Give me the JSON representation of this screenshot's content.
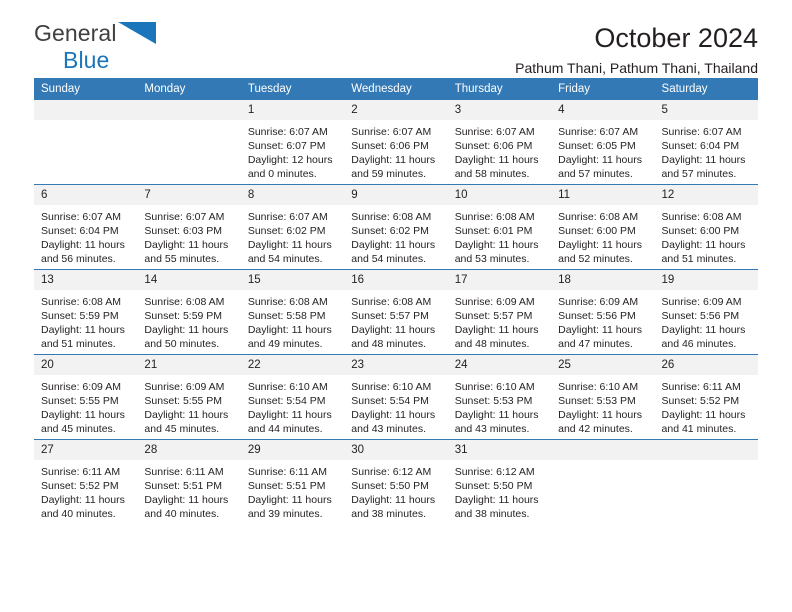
{
  "brand": {
    "name_line1": "General",
    "name_line2": "Blue",
    "triangle_color": "#1b75bb",
    "text_color": "#404041"
  },
  "header": {
    "title": "October 2024",
    "subtitle": "Pathum Thani, Pathum Thani, Thailand"
  },
  "colors": {
    "header_blue": "#3379b5",
    "daynum_band": "#f2f2f2",
    "text": "#231f20",
    "brand_blue": "#1b75bb"
  },
  "weekday_headers": [
    "Sunday",
    "Monday",
    "Tuesday",
    "Wednesday",
    "Thursday",
    "Friday",
    "Saturday"
  ],
  "weeks": [
    [
      {
        "day": "",
        "sunrise": "",
        "sunset": "",
        "daylight_line1": "",
        "daylight_line2": ""
      },
      {
        "day": "",
        "sunrise": "",
        "sunset": "",
        "daylight_line1": "",
        "daylight_line2": ""
      },
      {
        "day": "1",
        "sunrise": "Sunrise: 6:07 AM",
        "sunset": "Sunset: 6:07 PM",
        "daylight_line1": "Daylight: 12 hours",
        "daylight_line2": "and 0 minutes."
      },
      {
        "day": "2",
        "sunrise": "Sunrise: 6:07 AM",
        "sunset": "Sunset: 6:06 PM",
        "daylight_line1": "Daylight: 11 hours",
        "daylight_line2": "and 59 minutes."
      },
      {
        "day": "3",
        "sunrise": "Sunrise: 6:07 AM",
        "sunset": "Sunset: 6:06 PM",
        "daylight_line1": "Daylight: 11 hours",
        "daylight_line2": "and 58 minutes."
      },
      {
        "day": "4",
        "sunrise": "Sunrise: 6:07 AM",
        "sunset": "Sunset: 6:05 PM",
        "daylight_line1": "Daylight: 11 hours",
        "daylight_line2": "and 57 minutes."
      },
      {
        "day": "5",
        "sunrise": "Sunrise: 6:07 AM",
        "sunset": "Sunset: 6:04 PM",
        "daylight_line1": "Daylight: 11 hours",
        "daylight_line2": "and 57 minutes."
      }
    ],
    [
      {
        "day": "6",
        "sunrise": "Sunrise: 6:07 AM",
        "sunset": "Sunset: 6:04 PM",
        "daylight_line1": "Daylight: 11 hours",
        "daylight_line2": "and 56 minutes."
      },
      {
        "day": "7",
        "sunrise": "Sunrise: 6:07 AM",
        "sunset": "Sunset: 6:03 PM",
        "daylight_line1": "Daylight: 11 hours",
        "daylight_line2": "and 55 minutes."
      },
      {
        "day": "8",
        "sunrise": "Sunrise: 6:07 AM",
        "sunset": "Sunset: 6:02 PM",
        "daylight_line1": "Daylight: 11 hours",
        "daylight_line2": "and 54 minutes."
      },
      {
        "day": "9",
        "sunrise": "Sunrise: 6:08 AM",
        "sunset": "Sunset: 6:02 PM",
        "daylight_line1": "Daylight: 11 hours",
        "daylight_line2": "and 54 minutes."
      },
      {
        "day": "10",
        "sunrise": "Sunrise: 6:08 AM",
        "sunset": "Sunset: 6:01 PM",
        "daylight_line1": "Daylight: 11 hours",
        "daylight_line2": "and 53 minutes."
      },
      {
        "day": "11",
        "sunrise": "Sunrise: 6:08 AM",
        "sunset": "Sunset: 6:00 PM",
        "daylight_line1": "Daylight: 11 hours",
        "daylight_line2": "and 52 minutes."
      },
      {
        "day": "12",
        "sunrise": "Sunrise: 6:08 AM",
        "sunset": "Sunset: 6:00 PM",
        "daylight_line1": "Daylight: 11 hours",
        "daylight_line2": "and 51 minutes."
      }
    ],
    [
      {
        "day": "13",
        "sunrise": "Sunrise: 6:08 AM",
        "sunset": "Sunset: 5:59 PM",
        "daylight_line1": "Daylight: 11 hours",
        "daylight_line2": "and 51 minutes."
      },
      {
        "day": "14",
        "sunrise": "Sunrise: 6:08 AM",
        "sunset": "Sunset: 5:59 PM",
        "daylight_line1": "Daylight: 11 hours",
        "daylight_line2": "and 50 minutes."
      },
      {
        "day": "15",
        "sunrise": "Sunrise: 6:08 AM",
        "sunset": "Sunset: 5:58 PM",
        "daylight_line1": "Daylight: 11 hours",
        "daylight_line2": "and 49 minutes."
      },
      {
        "day": "16",
        "sunrise": "Sunrise: 6:08 AM",
        "sunset": "Sunset: 5:57 PM",
        "daylight_line1": "Daylight: 11 hours",
        "daylight_line2": "and 48 minutes."
      },
      {
        "day": "17",
        "sunrise": "Sunrise: 6:09 AM",
        "sunset": "Sunset: 5:57 PM",
        "daylight_line1": "Daylight: 11 hours",
        "daylight_line2": "and 48 minutes."
      },
      {
        "day": "18",
        "sunrise": "Sunrise: 6:09 AM",
        "sunset": "Sunset: 5:56 PM",
        "daylight_line1": "Daylight: 11 hours",
        "daylight_line2": "and 47 minutes."
      },
      {
        "day": "19",
        "sunrise": "Sunrise: 6:09 AM",
        "sunset": "Sunset: 5:56 PM",
        "daylight_line1": "Daylight: 11 hours",
        "daylight_line2": "and 46 minutes."
      }
    ],
    [
      {
        "day": "20",
        "sunrise": "Sunrise: 6:09 AM",
        "sunset": "Sunset: 5:55 PM",
        "daylight_line1": "Daylight: 11 hours",
        "daylight_line2": "and 45 minutes."
      },
      {
        "day": "21",
        "sunrise": "Sunrise: 6:09 AM",
        "sunset": "Sunset: 5:55 PM",
        "daylight_line1": "Daylight: 11 hours",
        "daylight_line2": "and 45 minutes."
      },
      {
        "day": "22",
        "sunrise": "Sunrise: 6:10 AM",
        "sunset": "Sunset: 5:54 PM",
        "daylight_line1": "Daylight: 11 hours",
        "daylight_line2": "and 44 minutes."
      },
      {
        "day": "23",
        "sunrise": "Sunrise: 6:10 AM",
        "sunset": "Sunset: 5:54 PM",
        "daylight_line1": "Daylight: 11 hours",
        "daylight_line2": "and 43 minutes."
      },
      {
        "day": "24",
        "sunrise": "Sunrise: 6:10 AM",
        "sunset": "Sunset: 5:53 PM",
        "daylight_line1": "Daylight: 11 hours",
        "daylight_line2": "and 43 minutes."
      },
      {
        "day": "25",
        "sunrise": "Sunrise: 6:10 AM",
        "sunset": "Sunset: 5:53 PM",
        "daylight_line1": "Daylight: 11 hours",
        "daylight_line2": "and 42 minutes."
      },
      {
        "day": "26",
        "sunrise": "Sunrise: 6:11 AM",
        "sunset": "Sunset: 5:52 PM",
        "daylight_line1": "Daylight: 11 hours",
        "daylight_line2": "and 41 minutes."
      }
    ],
    [
      {
        "day": "27",
        "sunrise": "Sunrise: 6:11 AM",
        "sunset": "Sunset: 5:52 PM",
        "daylight_line1": "Daylight: 11 hours",
        "daylight_line2": "and 40 minutes."
      },
      {
        "day": "28",
        "sunrise": "Sunrise: 6:11 AM",
        "sunset": "Sunset: 5:51 PM",
        "daylight_line1": "Daylight: 11 hours",
        "daylight_line2": "and 40 minutes."
      },
      {
        "day": "29",
        "sunrise": "Sunrise: 6:11 AM",
        "sunset": "Sunset: 5:51 PM",
        "daylight_line1": "Daylight: 11 hours",
        "daylight_line2": "and 39 minutes."
      },
      {
        "day": "30",
        "sunrise": "Sunrise: 6:12 AM",
        "sunset": "Sunset: 5:50 PM",
        "daylight_line1": "Daylight: 11 hours",
        "daylight_line2": "and 38 minutes."
      },
      {
        "day": "31",
        "sunrise": "Sunrise: 6:12 AM",
        "sunset": "Sunset: 5:50 PM",
        "daylight_line1": "Daylight: 11 hours",
        "daylight_line2": "and 38 minutes."
      },
      {
        "day": "",
        "sunrise": "",
        "sunset": "",
        "daylight_line1": "",
        "daylight_line2": ""
      },
      {
        "day": "",
        "sunrise": "",
        "sunset": "",
        "daylight_line1": "",
        "daylight_line2": ""
      }
    ]
  ]
}
